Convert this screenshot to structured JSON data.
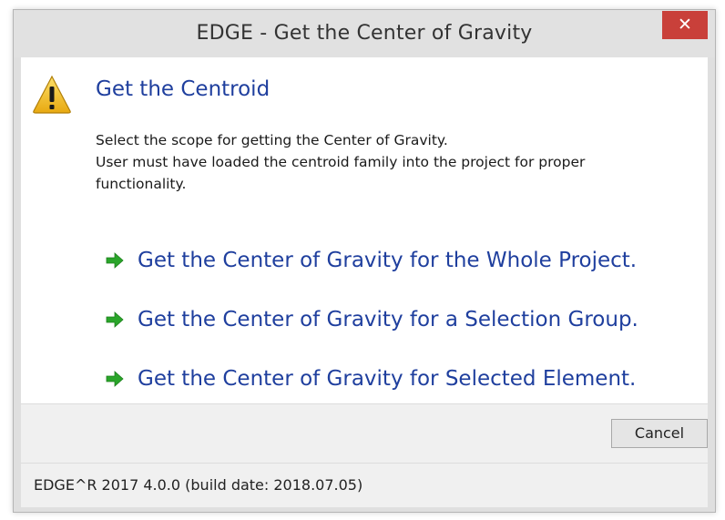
{
  "window": {
    "title": "EDGE - Get the Center of Gravity",
    "close_label": "✕"
  },
  "main": {
    "icon": "warning-icon",
    "heading": "Get the Centroid",
    "description_lines": [
      "Select the scope for getting the Center of Gravity.",
      "User must have loaded the centroid family into the project for proper",
      "functionality."
    ],
    "commands": [
      {
        "label": "Get the Center of Gravity for the Whole Project.",
        "icon": "green-arrow-icon"
      },
      {
        "label": "Get the Center of Gravity for a Selection Group.",
        "icon": "green-arrow-icon"
      },
      {
        "label": "Get the Center of Gravity for Selected Element.",
        "icon": "green-arrow-icon"
      }
    ]
  },
  "buttons": {
    "cancel_label": "Cancel"
  },
  "footer": {
    "text": "EDGE^R 2017 4.0.0 (build date: 2018.07.05)"
  },
  "colors": {
    "accent_text": "#1f3f9e",
    "close_button": "#c9403a",
    "arrow": "#2aa52a",
    "warning": "#f3c21b"
  }
}
